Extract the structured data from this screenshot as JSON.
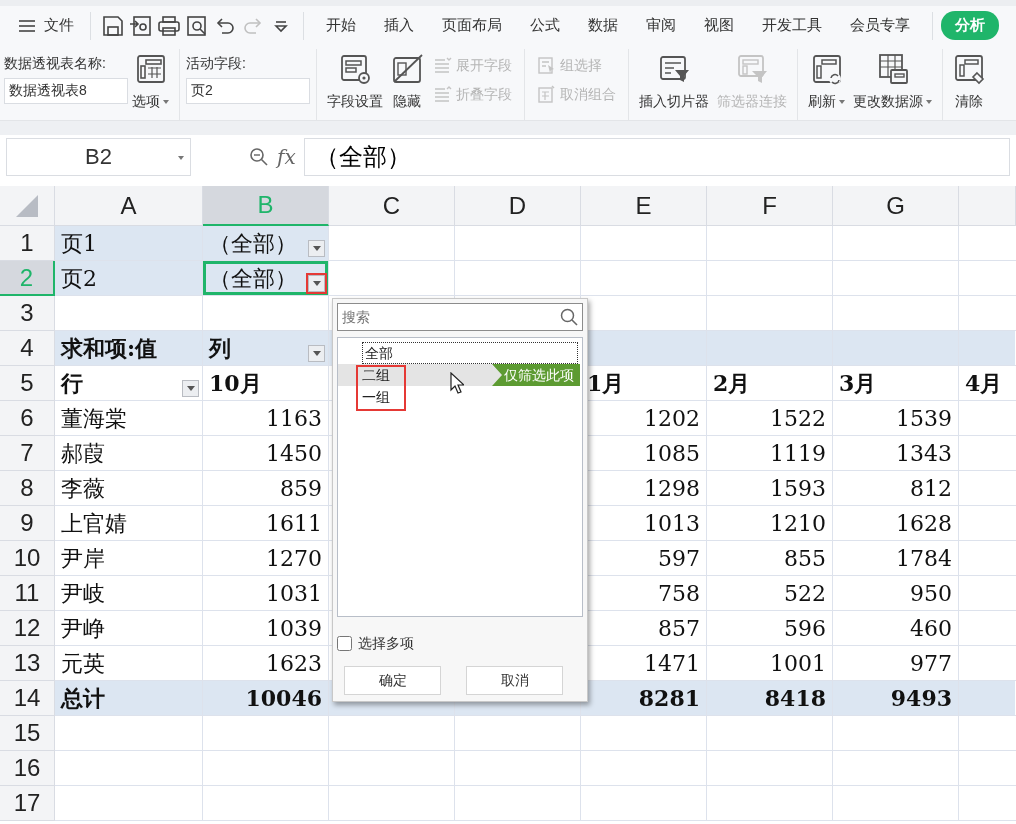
{
  "menu": {
    "file": "文件",
    "quick_access": [
      {
        "kind": "save",
        "disabled": false
      },
      {
        "kind": "export",
        "disabled": false
      },
      {
        "kind": "print",
        "disabled": false
      },
      {
        "kind": "preview",
        "disabled": false
      },
      {
        "kind": "undo",
        "disabled": false
      },
      {
        "kind": "redo",
        "disabled": true
      },
      {
        "kind": "customize",
        "disabled": false
      }
    ],
    "tabs": [
      {
        "label": "开始",
        "selected": false
      },
      {
        "label": "插入",
        "selected": false
      },
      {
        "label": "页面布局",
        "selected": false
      },
      {
        "label": "公式",
        "selected": false
      },
      {
        "label": "数据",
        "selected": false
      },
      {
        "label": "审阅",
        "selected": false
      },
      {
        "label": "视图",
        "selected": false
      },
      {
        "label": "开发工具",
        "selected": false
      },
      {
        "label": "会员专享",
        "selected": false
      },
      {
        "label": "分析",
        "selected": true
      }
    ]
  },
  "ribbon": {
    "pivot_name_label": "数据透视表名称:",
    "pivot_name": "数据透视表8",
    "options": {
      "label": "选项",
      "dropdown": true
    },
    "active_field_label": "活动字段:",
    "active_field": "页2",
    "groups": [
      {
        "tools": [
          {
            "label": "字段设置",
            "kind": "large",
            "disabled": false,
            "dropdown": false
          },
          {
            "label": "隐藏",
            "kind": "large",
            "disabled": false,
            "dropdown": false
          },
          {
            "label": "展开字段",
            "kind": "small",
            "disabled": true,
            "dropdown": false
          },
          {
            "label": "折叠字段",
            "kind": "small",
            "disabled": true,
            "dropdown": false
          }
        ]
      },
      {
        "tools": [
          {
            "label": "组选择",
            "kind": "small",
            "disabled": true,
            "dropdown": false
          },
          {
            "label": "取消组合",
            "kind": "small",
            "disabled": true,
            "dropdown": false
          }
        ]
      },
      {
        "tools": [
          {
            "label": "插入切片器",
            "kind": "large",
            "disabled": false,
            "dropdown": false
          },
          {
            "label": "筛选器连接",
            "kind": "large",
            "disabled": true,
            "dropdown": false
          }
        ]
      },
      {
        "tools": [
          {
            "label": "刷新",
            "kind": "large",
            "disabled": false,
            "dropdown": true
          },
          {
            "label": "更改数据源",
            "kind": "large",
            "disabled": false,
            "dropdown": true
          }
        ]
      },
      {
        "tools": [
          {
            "label": "清除",
            "kind": "large",
            "disabled": false,
            "dropdown": false
          }
        ]
      }
    ]
  },
  "formula_bar": {
    "name_box": "B2",
    "fx": "fx",
    "formula": "（全部）"
  },
  "sheet": {
    "columns": [
      {
        "label": "A",
        "selected": false
      },
      {
        "label": "B",
        "selected": true
      },
      {
        "label": "C",
        "selected": false
      },
      {
        "label": "D",
        "selected": false
      },
      {
        "label": "E",
        "selected": false
      },
      {
        "label": "F",
        "selected": false
      },
      {
        "label": "G",
        "selected": false
      }
    ],
    "rows": [
      {
        "number": "1",
        "selected": false,
        "kind": "page",
        "cells": [
          {
            "text": "页1"
          },
          {
            "text": "（全部）",
            "filter_button": true,
            "active": false,
            "marked": false
          }
        ]
      },
      {
        "number": "2",
        "selected": true,
        "kind": "page",
        "cells": [
          {
            "text": "页2"
          },
          {
            "text": "（全部）",
            "filter_button": true,
            "active": true,
            "marked": true
          }
        ]
      },
      {
        "number": "3",
        "selected": false,
        "kind": "empty",
        "cells": []
      },
      {
        "number": "4",
        "selected": false,
        "kind": "pivot-header",
        "cells": [
          {
            "text": "求和项:值"
          },
          {
            "text": "列",
            "filter_button": true,
            "active": false,
            "marked": false
          }
        ]
      },
      {
        "number": "5",
        "selected": false,
        "kind": "column-labels",
        "cells": [
          {
            "text": "行",
            "filter_button": true,
            "active": false,
            "marked": false
          },
          {
            "text": "10月"
          },
          null,
          null,
          {
            "text": "1月"
          },
          {
            "text": "2月"
          },
          {
            "text": "3月"
          },
          {
            "text": "4月"
          }
        ]
      },
      {
        "number": "6",
        "selected": false,
        "kind": "data",
        "cells": [
          {
            "text": "董海棠"
          },
          {
            "text": "1163"
          },
          null,
          null,
          {
            "text": "1202"
          },
          {
            "text": "1522"
          },
          {
            "text": "1539"
          }
        ]
      },
      {
        "number": "7",
        "selected": false,
        "kind": "data",
        "cells": [
          {
            "text": "郝葭"
          },
          {
            "text": "1450"
          },
          null,
          null,
          {
            "text": "1085"
          },
          {
            "text": "1119"
          },
          {
            "text": "1343"
          }
        ]
      },
      {
        "number": "8",
        "selected": false,
        "kind": "data",
        "cells": [
          {
            "text": "李薇"
          },
          {
            "text": "859"
          },
          null,
          null,
          {
            "text": "1298"
          },
          {
            "text": "1593"
          },
          {
            "text": "812"
          }
        ]
      },
      {
        "number": "9",
        "selected": false,
        "kind": "data",
        "cells": [
          {
            "text": "上官婧"
          },
          {
            "text": "1611"
          },
          null,
          null,
          {
            "text": "1013"
          },
          {
            "text": "1210"
          },
          {
            "text": "1628"
          }
        ]
      },
      {
        "number": "10",
        "selected": false,
        "kind": "data",
        "cells": [
          {
            "text": "尹岸"
          },
          {
            "text": "1270"
          },
          null,
          null,
          {
            "text": "597"
          },
          {
            "text": "855"
          },
          {
            "text": "1784"
          }
        ]
      },
      {
        "number": "11",
        "selected": false,
        "kind": "data",
        "cells": [
          {
            "text": "尹岐"
          },
          {
            "text": "1031"
          },
          null,
          null,
          {
            "text": "758"
          },
          {
            "text": "522"
          },
          {
            "text": "950"
          }
        ]
      },
      {
        "number": "12",
        "selected": false,
        "kind": "data",
        "cells": [
          {
            "text": "尹峥"
          },
          {
            "text": "1039"
          },
          null,
          null,
          {
            "text": "857"
          },
          {
            "text": "596"
          },
          {
            "text": "460"
          }
        ]
      },
      {
        "number": "13",
        "selected": false,
        "kind": "data",
        "cells": [
          {
            "text": "元英"
          },
          {
            "text": "1623"
          },
          null,
          null,
          {
            "text": "1471"
          },
          {
            "text": "1001"
          },
          {
            "text": "977"
          }
        ]
      },
      {
        "number": "14",
        "selected": false,
        "kind": "total",
        "cells": [
          {
            "text": "总计"
          },
          {
            "text": "10046"
          },
          null,
          null,
          {
            "text": "8281"
          },
          {
            "text": "8418"
          },
          {
            "text": "9493"
          }
        ]
      },
      {
        "number": "15",
        "selected": false,
        "kind": "empty",
        "cells": []
      },
      {
        "number": "16",
        "selected": false,
        "kind": "empty",
        "cells": []
      },
      {
        "number": "17",
        "selected": false,
        "kind": "empty",
        "cells": []
      }
    ]
  },
  "filter_popup": {
    "search_placeholder": "搜索",
    "items": [
      {
        "label": "全部",
        "focused": true,
        "hovered": false,
        "marked": false
      },
      {
        "label": "二组",
        "focused": false,
        "hovered": true,
        "marked": true
      },
      {
        "label": "一组",
        "focused": false,
        "hovered": false,
        "marked": true
      }
    ],
    "only_this_tag": "仅筛选此项",
    "multi_select": {
      "label": "选择多项",
      "checked": false
    },
    "buttons": [
      "确定",
      "取消"
    ]
  }
}
